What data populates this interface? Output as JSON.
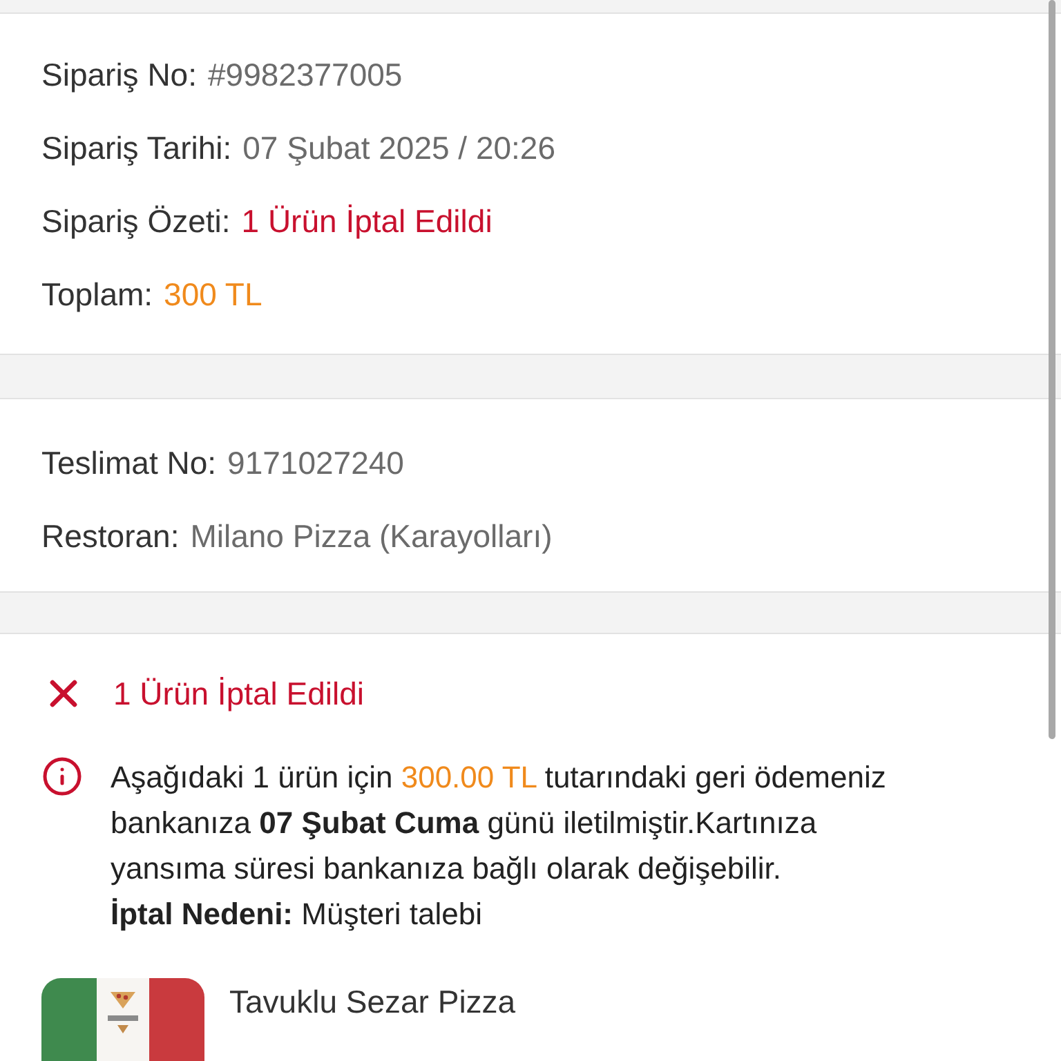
{
  "order": {
    "fields": [
      {
        "label": "Sipariş No:",
        "value": "#9982377005",
        "kind": "muted"
      },
      {
        "label": "Sipariş Tarihi:",
        "value": "07 Şubat 2025 / 20:26",
        "kind": "muted"
      },
      {
        "label": "Sipariş Özeti:",
        "value": "1 Ürün İptal Edildi",
        "kind": "danger"
      },
      {
        "label": "Toplam:",
        "value": "300 TL",
        "kind": "accent"
      }
    ]
  },
  "delivery": {
    "fields": [
      {
        "label": "Teslimat No:",
        "value": "9171027240",
        "kind": "muted"
      },
      {
        "label": "Restoran:",
        "value": "Milano Pizza (Karayolları)",
        "kind": "muted"
      }
    ]
  },
  "cancellation": {
    "title": "1 Ürün İptal Edildi",
    "message": [
      {
        "text": "Aşağıdaki 1 ürün için ",
        "kind": "plain"
      },
      {
        "text": "300.00 TL",
        "kind": "amount"
      },
      {
        "text": " tutarındaki geri ödemeniz bankanıza ",
        "kind": "plain"
      },
      {
        "text": "07 Şubat Cuma",
        "kind": "bold"
      },
      {
        "text": " günü iletilmiştir.Kartınıza yansıma süresi bankanıza bağlı olarak değişebilir.",
        "kind": "plain"
      }
    ],
    "reason": "**İptal Nedeni:** Müşteri talebi"
  },
  "products": [
    {
      "name": "Tavuklu Sezar Pizza"
    }
  ]
}
